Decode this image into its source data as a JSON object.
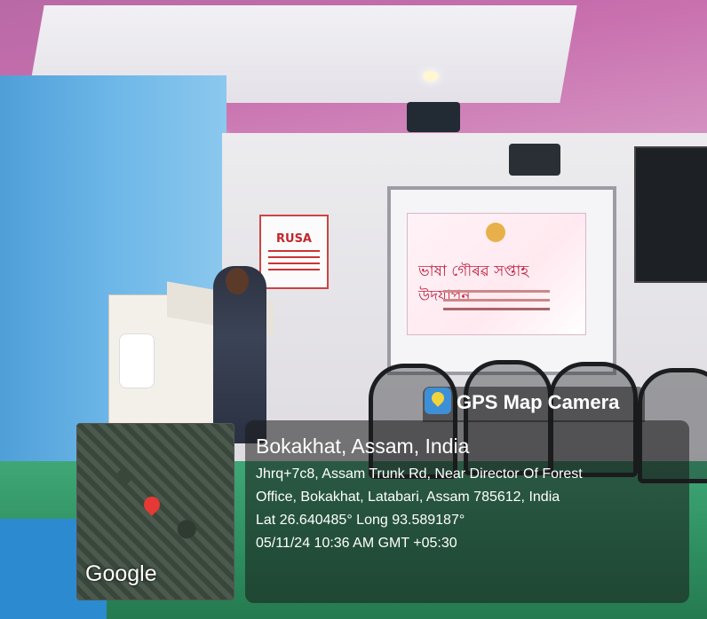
{
  "scene": {
    "projection_title": "ভাষা গৌৰৱ সপ্তাহ উদযাপন",
    "poster_title": "RUSA"
  },
  "gps_overlay": {
    "app_badge": "GPS Map Camera",
    "location_title": "Bokakhat, Assam, India",
    "address_line_1": "Jhrq+7c8, Assam Trunk Rd, Near Director Of Forest",
    "address_line_2": "Office, Bokakhat, Latabari, Assam 785612, India",
    "coordinates": "Lat 26.640485° Long 93.589187°",
    "timestamp": "05/11/24 10:36 AM GMT +05:30",
    "map_attribution": "Google",
    "icon": "map-pin-icon"
  }
}
